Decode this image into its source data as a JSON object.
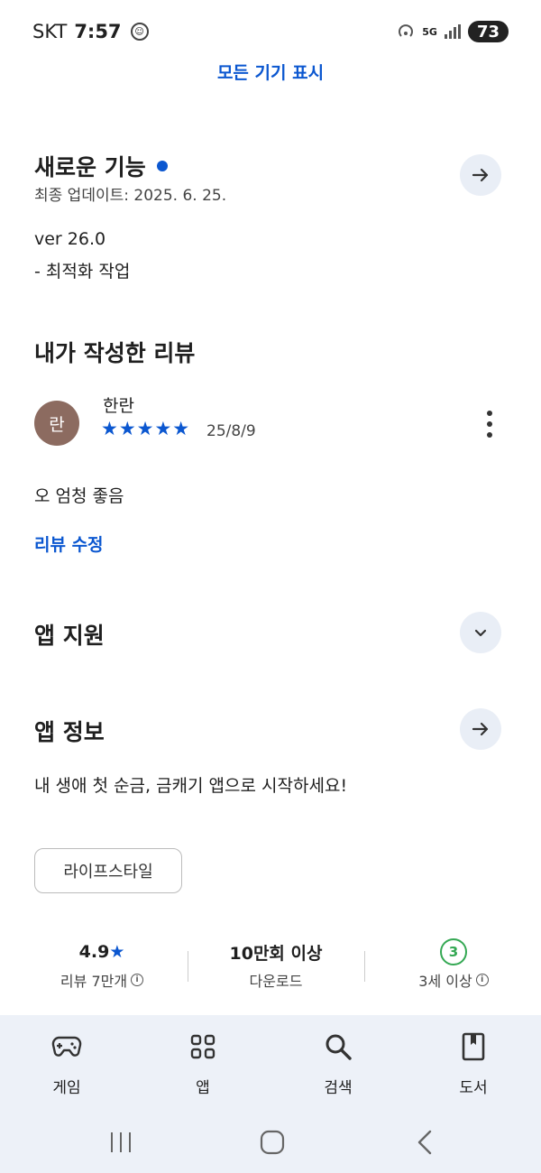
{
  "status_bar": {
    "carrier": "SKT",
    "time": "7:57",
    "network": "5G",
    "battery": "73"
  },
  "show_all_devices": "모든 기기 표시",
  "whats_new": {
    "title": "새로운 기능",
    "updated": "최종 업데이트: 2025. 6. 25.",
    "version": "ver 26.0",
    "notes": "- 최적화 작업"
  },
  "my_review": {
    "title": "내가 작성한 리뷰",
    "avatar_letter": "란",
    "reviewer": "한란",
    "stars": "★★★★★",
    "rating": 5,
    "date": "25/8/9",
    "text": "오 엄청 좋음",
    "edit_label": "리뷰 수정"
  },
  "app_support": {
    "title": "앱 지원"
  },
  "app_info": {
    "title": "앱 정보",
    "description": "내 생애 첫 순금, 금캐기 앱으로 시작하세요!",
    "category": "라이프스타일"
  },
  "stats": {
    "rating_value": "4.9",
    "rating_star": "★",
    "reviews": "리뷰 7만개",
    "downloads_value": "10만회 이상",
    "downloads_label": "다운로드",
    "age_value": "3",
    "age_label": "3세 이상"
  },
  "bottom_nav": [
    {
      "label": "게임",
      "icon": "gamepad-icon"
    },
    {
      "label": "앱",
      "icon": "apps-grid-icon"
    },
    {
      "label": "검색",
      "icon": "search-icon"
    },
    {
      "label": "도서",
      "icon": "book-icon"
    }
  ],
  "colors": {
    "accent": "#0b57d0",
    "button_bg": "#e9eef6",
    "nav_bg": "#edf1f8",
    "avatar": "#8c6b60",
    "age_badge": "#34a853"
  }
}
